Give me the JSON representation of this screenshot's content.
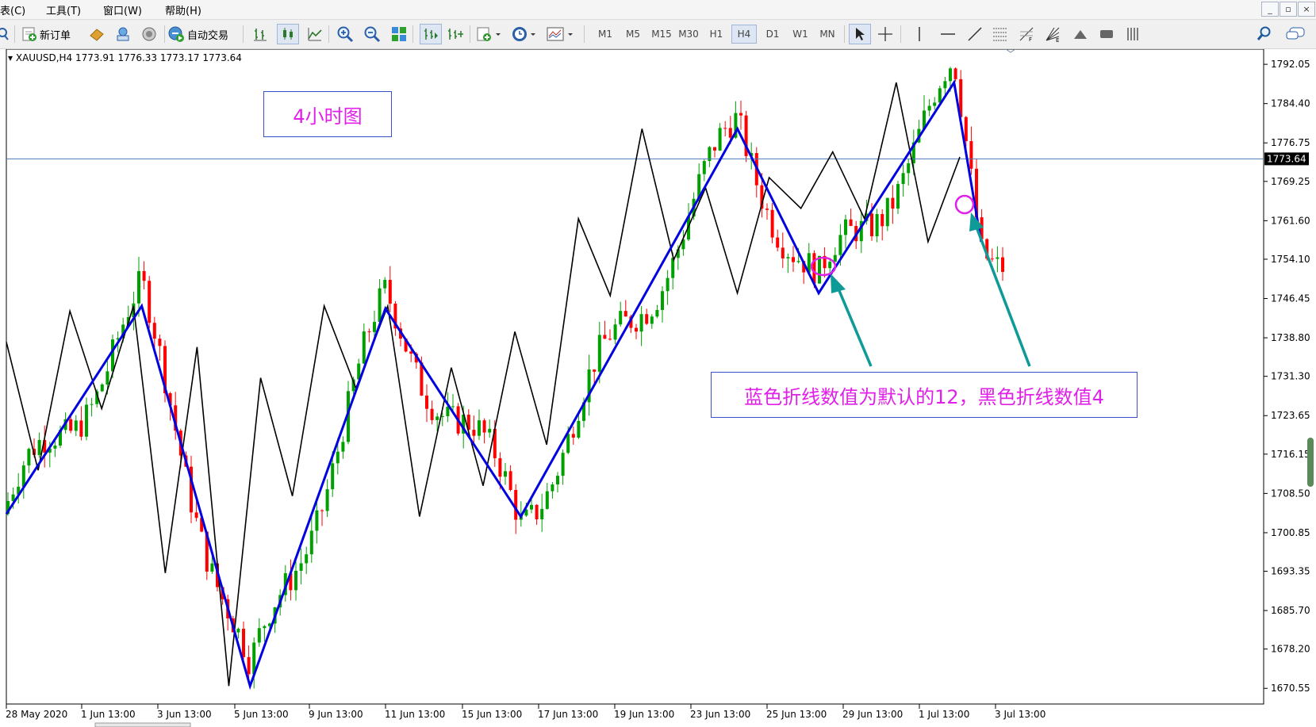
{
  "menubar": {
    "items": [
      "表(C)",
      "工具(T)",
      "窗口(W)",
      "帮助(H)"
    ],
    "window_buttons": [
      "_",
      "▫",
      "×"
    ]
  },
  "toolbar": {
    "new_order_label": "新订单",
    "auto_trading_label": "自动交易",
    "timeframes": [
      "M1",
      "M5",
      "M15",
      "M30",
      "H1",
      "H4",
      "D1",
      "W1",
      "MN"
    ],
    "active_timeframe": "H4"
  },
  "chart": {
    "symbol_info": "XAUUSD,H4  1773.91 1776.33 1773.17 1773.64",
    "current_price": "1773.64",
    "price_ticks": [
      "1792.05",
      "1784.40",
      "1776.75",
      "1769.25",
      "1761.60",
      "1754.10",
      "1746.45",
      "1738.80",
      "1731.30",
      "1723.65",
      "1716.15",
      "1708.50",
      "1700.85",
      "1693.35",
      "1685.70",
      "1678.20",
      "1670.55"
    ],
    "time_ticks": [
      "28 May 2020",
      "1 Jun 13:00",
      "3 Jun 13:00",
      "5 Jun 13:00",
      "9 Jun 13:00",
      "11 Jun 13:00",
      "15 Jun 13:00",
      "17 Jun 13:00",
      "19 Jun 13:00",
      "23 Jun 13:00",
      "25 Jun 13:00",
      "29 Jun 13:00",
      "1 Jul 13:00",
      "3 Jul 13:00"
    ],
    "label_4h": "4小时图",
    "label_note": "蓝色折线数值为默认的12，黑色折线数值4",
    "colors": {
      "bull_candle": "#00a000",
      "bear_candle": "#ff0000",
      "zigzag_default": "#0000e0",
      "zigzag_small": "#000000",
      "annotation_text": "#e020e8",
      "annotation_arrow": "#0e9a96",
      "price_line": "#4a7ab8"
    }
  },
  "chart_data": {
    "type": "candlestick",
    "y_range": [
      1667.5,
      1795.0
    ],
    "zigzag_default_12": [
      {
        "time": "27 May 2020",
        "price": 1704.5
      },
      {
        "time": "1 Jun 2020",
        "price": 1745.0
      },
      {
        "time": "5 Jun 2020",
        "price": 1671.0
      },
      {
        "time": "10 Jun 2020",
        "price": 1744.5
      },
      {
        "time": "15 Jun 2020",
        "price": 1704.0
      },
      {
        "time": "23 Jun 2020",
        "price": 1779.5
      },
      {
        "time": "26 Jun 2020",
        "price": 1747.5
      },
      {
        "time": "1 Jul 2020",
        "price": 1788.5
      },
      {
        "time": "2 Jul 2020",
        "price": 1757.5
      }
    ]
  }
}
